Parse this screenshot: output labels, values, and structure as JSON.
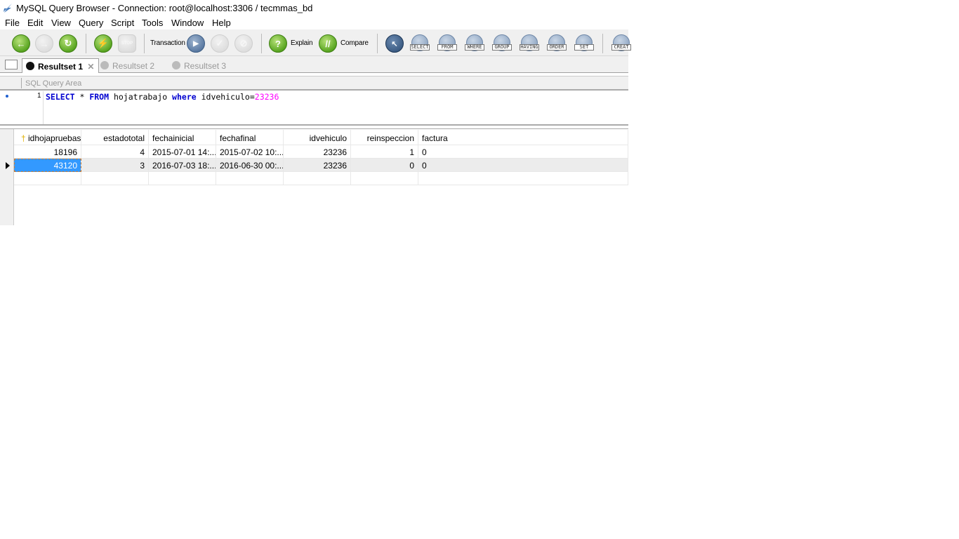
{
  "window": {
    "title": "MySQL Query Browser - Connection: root@localhost:3306 / tecmmas_bd"
  },
  "menu": [
    "File",
    "Edit",
    "View",
    "Query",
    "Script",
    "Tools",
    "Window",
    "Help"
  ],
  "toolbar": {
    "transaction_label": "Transaction",
    "explain_label": "Explain",
    "compare_label": "Compare",
    "clauses": [
      "SELECT",
      "FROM",
      "WHERE",
      "GROUP",
      "HAVING",
      "ORDER",
      "SET"
    ],
    "create_label": "CREAT"
  },
  "tabs": [
    {
      "label": "Resultset 1",
      "active": true
    },
    {
      "label": "Resultset 2"
    },
    {
      "label": "Resultset 3"
    }
  ],
  "query_area": {
    "label": "SQL Query Area",
    "line": "1",
    "tokens": [
      "SELECT",
      " * ",
      "FROM",
      " hojatrabajo ",
      "where",
      " idvehiculo=",
      "23236"
    ]
  },
  "grid": {
    "columns": [
      "idhojapruebas",
      "estadototal",
      "fechainicial",
      "fechafinal",
      "idvehiculo",
      "reinspeccion",
      "factura"
    ],
    "rows": [
      [
        "18196",
        "4",
        "2015-07-01 14:...",
        "2015-07-02 10:...",
        "23236",
        "1",
        "0"
      ],
      [
        "43120",
        "3",
        "2016-07-03 18:...",
        "2016-06-30 00:...",
        "23236",
        "0",
        "0"
      ]
    ],
    "selected_row": 1
  }
}
